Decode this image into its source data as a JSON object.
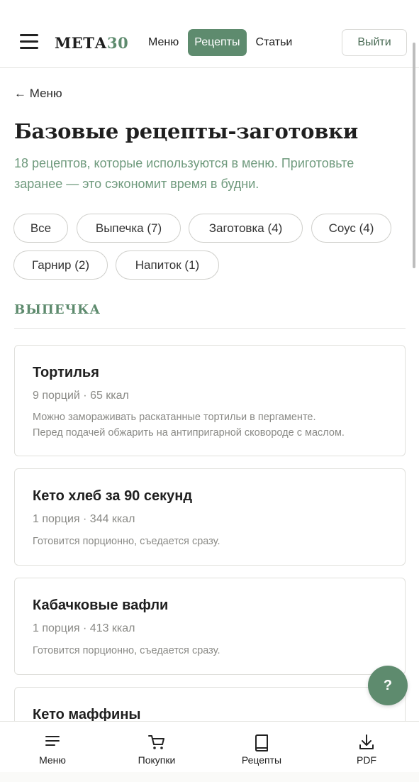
{
  "header": {
    "logo_main": "МЕТА",
    "logo_num": "30",
    "nav": [
      {
        "label": "Меню",
        "active": false
      },
      {
        "label": "Рецепты",
        "active": true
      },
      {
        "label": "Статьи",
        "active": false
      }
    ],
    "logout_label": "Выйти"
  },
  "page": {
    "back_label": "← Меню",
    "title": "Базовые рецепты-заготовки",
    "subtitle": "18 рецептов, которые используются в меню. Приготовьте заранее — это сэкономит время в будни."
  },
  "filters": [
    "Все",
    "Выпечка (7)",
    "Заготовка (4)",
    "Соус (4)",
    "Гарнир (2)",
    "Напиток (1)"
  ],
  "section": {
    "title": "ВЫПЕЧКА"
  },
  "recipes": [
    {
      "title": "Тортилья",
      "meta": "9 порций · 65 ккал",
      "desc_line1": "Можно замораживать раскатанные тортильи в пергаменте.",
      "desc_line2": "Перед подачей обжарить на антипригарной сковороде с маслом."
    },
    {
      "title": "Кето хлеб за 90 секунд",
      "meta": "1 порция · 344 ккал",
      "desc_line1": "Готовится порционно, съедается сразу."
    },
    {
      "title": "Кабачковые вафли",
      "meta": "1 порция · 413 ккал",
      "desc_line1": "Готовится порционно, съедается сразу."
    },
    {
      "title": "Кето маффины"
    }
  ],
  "help_label": "?",
  "bottom_nav": [
    {
      "label": "Меню",
      "icon": "list-icon"
    },
    {
      "label": "Покупки",
      "icon": "cart-icon"
    },
    {
      "label": "Рецепты",
      "icon": "book-icon"
    },
    {
      "label": "PDF",
      "icon": "download-icon"
    }
  ],
  "colors": {
    "accent": "#5e8b6e",
    "subtitle": "#6f9a7d",
    "border": "#e0e0dc"
  }
}
